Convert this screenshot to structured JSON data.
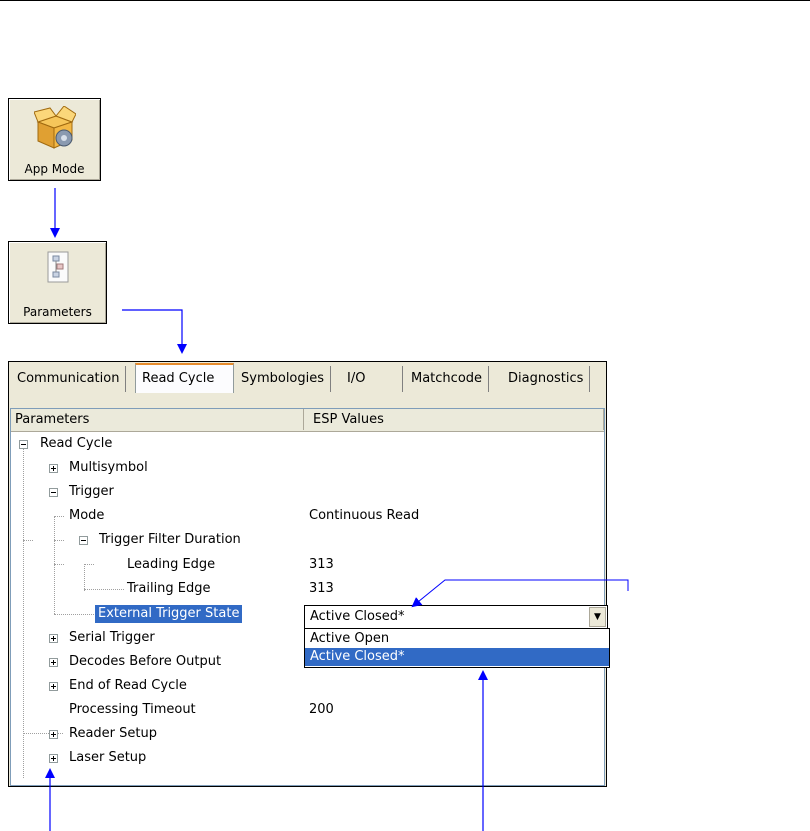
{
  "toolbar": {
    "app_mode_label": "App Mode",
    "parameters_label": "Parameters"
  },
  "tabs": [
    {
      "label": "Communication"
    },
    {
      "label": "Read Cycle",
      "active": true
    },
    {
      "label": "Symbologies"
    },
    {
      "label": "I/O"
    },
    {
      "label": "Matchcode"
    },
    {
      "label": "Diagnostics"
    }
  ],
  "table": {
    "col_parameters": "Parameters",
    "col_values": "ESP Values"
  },
  "tree": [
    {
      "label": "Read Cycle",
      "value": "",
      "expander": "minus"
    },
    {
      "label": "Multisymbol",
      "value": "",
      "expander": "plus"
    },
    {
      "label": "Trigger",
      "value": "",
      "expander": "minus"
    },
    {
      "label": "Mode",
      "value": "Continuous Read",
      "expander": "none"
    },
    {
      "label": "Trigger Filter Duration",
      "value": "",
      "expander": "minus"
    },
    {
      "label": "Leading Edge",
      "value": "313",
      "expander": "none"
    },
    {
      "label": "Trailing Edge",
      "value": "313",
      "expander": "none"
    },
    {
      "label": "External Trigger State",
      "value": "",
      "expander": "none",
      "selected": true
    },
    {
      "label": "Serial Trigger",
      "value": "",
      "expander": "plus"
    },
    {
      "label": "Decodes Before Output",
      "value": "",
      "expander": "plus"
    },
    {
      "label": "End of Read Cycle",
      "value": "",
      "expander": "plus"
    },
    {
      "label": "Processing Timeout",
      "value": "200",
      "expander": "none"
    },
    {
      "label": "Reader Setup",
      "value": "",
      "expander": "plus"
    },
    {
      "label": "Laser Setup",
      "value": "",
      "expander": "plus"
    }
  ],
  "combo": {
    "value": "Active Closed*",
    "options": [
      "Active Open",
      "Active Closed*"
    ],
    "highlighted_index": 1
  },
  "colors": {
    "selection": "#316ac5",
    "arrow": "#0000ff",
    "tab_accent": "#e68b2c"
  }
}
